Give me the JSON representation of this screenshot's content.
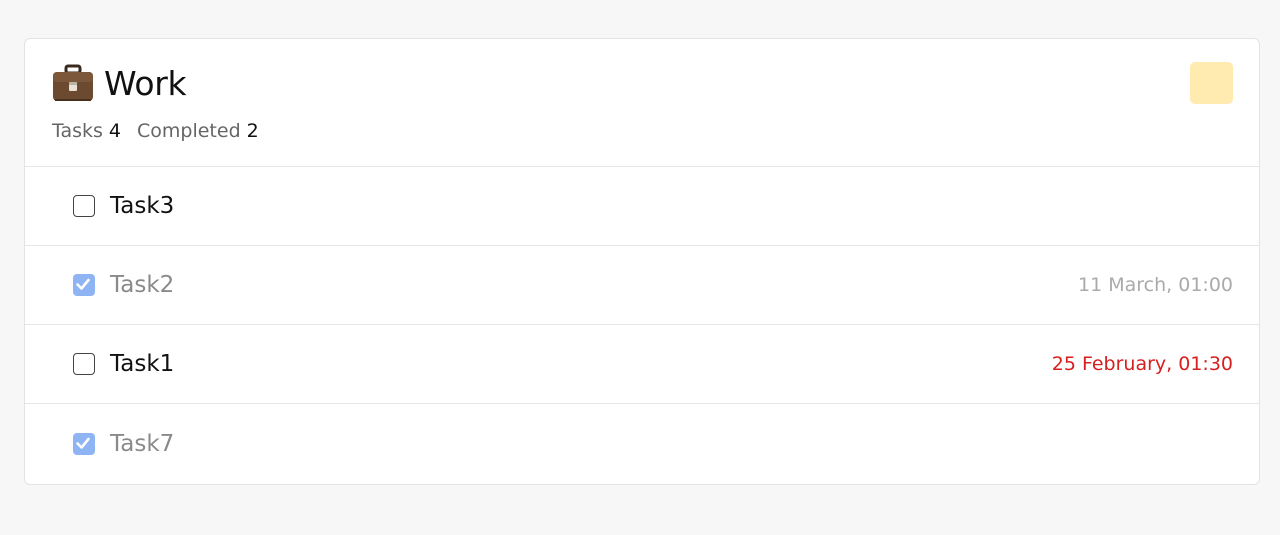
{
  "list": {
    "title": "Work",
    "icon": "briefcase-icon",
    "color": "#ffeab0",
    "stats": {
      "tasks_label": "Tasks",
      "tasks_count": "4",
      "completed_label": "Completed",
      "completed_count": "2"
    }
  },
  "tasks": [
    {
      "name": "Task3",
      "checked": false,
      "due": "",
      "overdue": false
    },
    {
      "name": "Task2",
      "checked": true,
      "due": "11 March, 01:00",
      "overdue": false
    },
    {
      "name": "Task1",
      "checked": false,
      "due": "25 February, 01:30",
      "overdue": true
    },
    {
      "name": "Task7",
      "checked": true,
      "due": "",
      "overdue": false
    }
  ],
  "colors": {
    "overdue": "#d61f1f",
    "checkbox_checked": "#8fb4f3"
  }
}
